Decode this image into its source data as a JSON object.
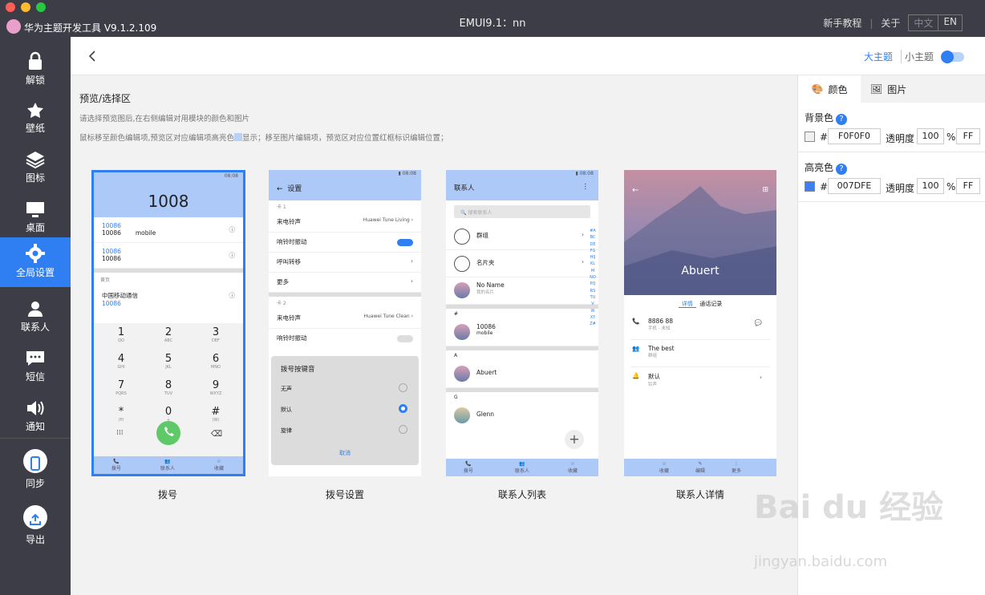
{
  "titlebar": {
    "app_title": "华为主题开发工具 V9.1.2.109",
    "window_title": "EMUI9.1：nn",
    "tutorial": "新手教程",
    "about": "关于",
    "lang_zh": "中文",
    "lang_en": "EN"
  },
  "sidebar": {
    "items": [
      {
        "label": "解锁",
        "icon": "lock-icon"
      },
      {
        "label": "壁纸",
        "icon": "wallpaper-icon"
      },
      {
        "label": "图标",
        "icon": "layers-icon"
      },
      {
        "label": "桌面",
        "icon": "monitor-icon"
      },
      {
        "label": "全局设置",
        "icon": "gear-icon"
      },
      {
        "label": "联系人",
        "icon": "person-icon"
      },
      {
        "label": "短信",
        "icon": "message-icon"
      },
      {
        "label": "通知",
        "icon": "speaker-icon"
      },
      {
        "label": "同步",
        "icon": "phone-icon"
      },
      {
        "label": "导出",
        "icon": "export-icon"
      }
    ]
  },
  "header": {
    "theme_big": "大主题",
    "theme_small": "小主题"
  },
  "preview": {
    "title": "预览/选择区",
    "hint1": "请选择预览图后,在右侧编辑对用模块的颜色和图片",
    "hint2a": "鼠标移至颜色编辑项,预览区对应编辑项高亮色",
    "hint2b": "显示；移至图片编辑项，预览区对应位置红框标识编辑位置；",
    "captions": [
      "拨号",
      "拨号设置",
      "联系人列表",
      "联系人详情"
    ]
  },
  "phone1": {
    "time": "08:08",
    "number": "1008",
    "calls": [
      {
        "num": "10086",
        "sub": "10086",
        "tag": "mobile"
      },
      {
        "num": "10086",
        "sub": "10086",
        "tag": ""
      }
    ],
    "section": "黄页",
    "yp_name": "中国移动通信",
    "yp_num": "10086",
    "keys": [
      {
        "d": "1",
        "l": "QO"
      },
      {
        "d": "2",
        "l": "ABC"
      },
      {
        "d": "3",
        "l": "DEF"
      },
      {
        "d": "4",
        "l": "GHI"
      },
      {
        "d": "5",
        "l": "JKL"
      },
      {
        "d": "6",
        "l": "MNO"
      },
      {
        "d": "7",
        "l": "PQRS"
      },
      {
        "d": "8",
        "l": "TUV"
      },
      {
        "d": "9",
        "l": "WXYZ"
      },
      {
        "d": "*",
        "l": "(P)"
      },
      {
        "d": "0",
        "l": "+"
      },
      {
        "d": "#",
        "l": "(W)"
      }
    ],
    "nav": [
      "拨号",
      "联系人",
      "收藏"
    ]
  },
  "phone2": {
    "title": "设置",
    "card1": "卡 1",
    "ringtone": "来电铃声",
    "ring_val1": "Huawei Tune Living",
    "vibrate": "响铃时振动",
    "forward": "呼叫转移",
    "more": "更多",
    "card2": "卡 2",
    "ring_val2": "Huawei Tune Clean",
    "dialog_title": "拨号按键音",
    "opt1": "无声",
    "opt2": "默认",
    "opt3": "旋律",
    "cancel": "取消"
  },
  "phone3": {
    "title": "联系人",
    "search": "搜索联系人",
    "groups": "群组",
    "cards": "名片夹",
    "noname": "No Name",
    "mycard": "我的名片",
    "hash": "#",
    "c1": "10086",
    "c1sub": "mobile",
    "a": "A",
    "c2": "Abuert",
    "g": "G",
    "c3": "Glenn",
    "nav": [
      "拨号",
      "联系人",
      "收藏"
    ],
    "letters": "#ABCDEFGHIJKLMNOPQRSTUVWXYZ#"
  },
  "phone4": {
    "name": "Abuert",
    "tab1": "详情",
    "tab2": "通话记录",
    "phone": "8886 88",
    "phone_sub": "手机 - 未知",
    "group": "The best",
    "group_sub": "群组",
    "ring": "默认",
    "ring_sub": "铃声",
    "nav": [
      "收藏",
      "编辑",
      "更多"
    ]
  },
  "panel": {
    "tab_color": "颜色",
    "tab_image": "图片",
    "bg_label": "背景色",
    "bg_hex": "F0F0F0",
    "bg_color": "#F0F0F0",
    "bg_alpha": "100",
    "bg_alpha_hex": "FF",
    "hl_label": "高亮色",
    "hl_hex": "007DFE",
    "hl_color": "#3d7ff0",
    "hl_alpha": "100",
    "hl_alpha_hex": "FF",
    "hash": "#",
    "alpha_label": "透明度",
    "pct": "%",
    "q": "?"
  },
  "watermark": {
    "text1": "Bai du 经验",
    "text2": "jingyan.baidu.com"
  }
}
